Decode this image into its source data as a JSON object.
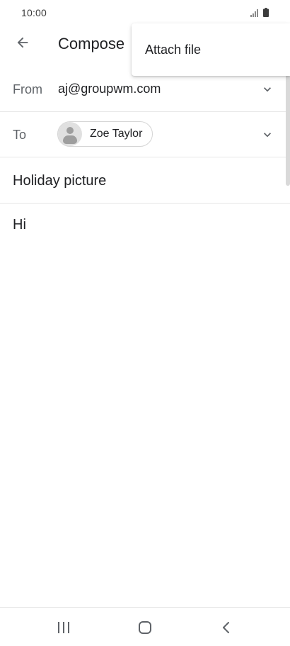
{
  "status_bar": {
    "time": "10:00",
    "icons": [
      "signal-icon",
      "battery-icon"
    ]
  },
  "app_bar": {
    "title": "Compose",
    "back_icon": "arrow-left-icon"
  },
  "menu": {
    "items": [
      {
        "label": "Attach file"
      }
    ]
  },
  "fields": {
    "from": {
      "label": "From",
      "value": "aj@groupwm.com"
    },
    "to": {
      "label": "To",
      "recipients": [
        {
          "name": "Zoe Taylor"
        }
      ]
    },
    "subject": "Holiday picture",
    "body": "Hi"
  },
  "nav_bar": {
    "icons": [
      "recents-icon",
      "home-icon",
      "back-icon"
    ]
  },
  "colors": {
    "text": "#202124",
    "label": "#5f6368",
    "divider": "#e6e6e6",
    "icon": "#5f6368"
  }
}
